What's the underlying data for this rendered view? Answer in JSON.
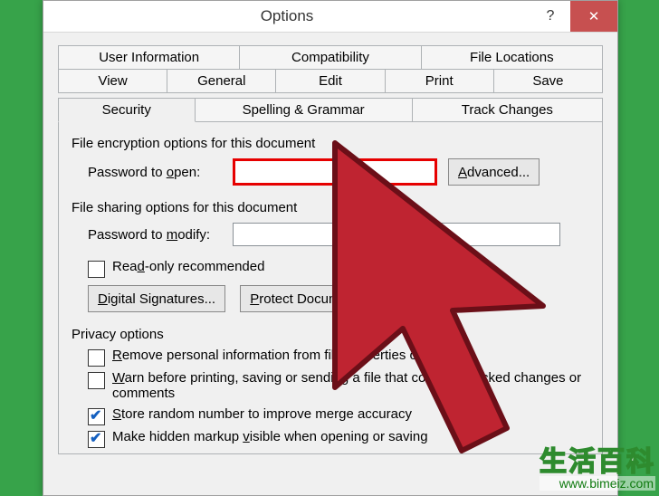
{
  "window": {
    "title": "Options",
    "help": "?",
    "close": "✕"
  },
  "tabs": {
    "row1": [
      "User Information",
      "Compatibility",
      "File Locations"
    ],
    "row2": [
      "View",
      "General",
      "Edit",
      "Print",
      "Save"
    ],
    "row3": [
      "Security",
      "Spelling & Grammar",
      "Track Changes"
    ],
    "active": "Security"
  },
  "security": {
    "encryption_group": "File encryption options for this document",
    "password_open_pre": "Password to ",
    "password_open_u": "o",
    "password_open_post": "pen:",
    "advanced_u": "A",
    "advanced_post": "dvanced...",
    "sharing_group": "File sharing options for this document",
    "password_modify_pre": "Password to ",
    "password_modify_u": "m",
    "password_modify_post": "odify:",
    "readonly_pre": "Rea",
    "readonly_u": "d",
    "readonly_post": "-only recommended",
    "digital_u": "D",
    "digital_post": "igital Signatures...",
    "protect_u": "P",
    "protect_post": "rotect Document...",
    "privacy_group": "Privacy options",
    "remove_u": "R",
    "remove_post": "emove personal information from file properties on save",
    "warn_u": "W",
    "warn_post": "arn before printing, saving or sending a file that contains tracked changes or comments",
    "store_u": "S",
    "store_post": "tore random number to improve merge accuracy",
    "visible_pre": "Make hidden markup ",
    "visible_u": "v",
    "visible_post": "isible when opening or saving"
  },
  "checks": {
    "readonly": false,
    "remove": false,
    "warn": false,
    "store": true,
    "visible": true
  },
  "watermark": {
    "zh": "生活百科",
    "url": "www.bimeiz.com"
  }
}
